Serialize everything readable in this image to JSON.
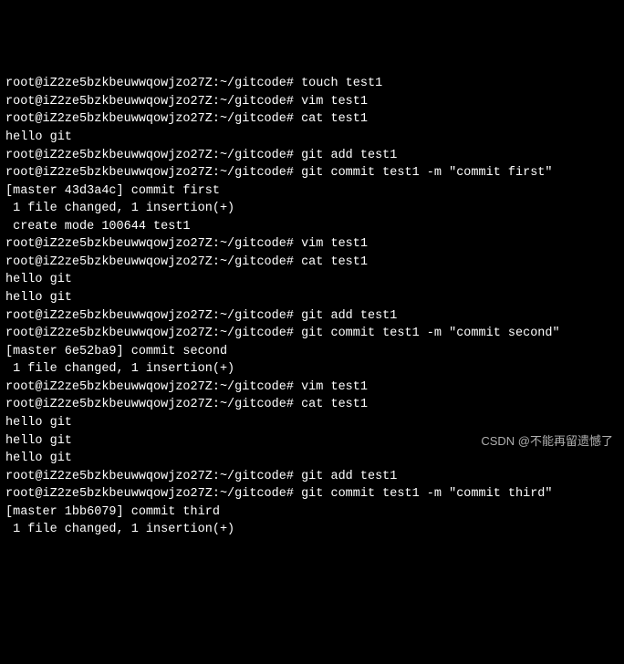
{
  "terminal": {
    "prompt_prefix": "root@iZ2ze5bzkbeuwwqowjzo27Z:~/gitcode#",
    "lines": [
      {
        "type": "prompt",
        "cmd": "touch test1"
      },
      {
        "type": "prompt",
        "cmd": "vim test1"
      },
      {
        "type": "prompt",
        "cmd": "cat test1"
      },
      {
        "type": "output",
        "text": "hello git"
      },
      {
        "type": "prompt",
        "cmd": "git add test1"
      },
      {
        "type": "prompt",
        "cmd": "git commit test1 -m \"commit first\""
      },
      {
        "type": "output",
        "text": "[master 43d3a4c] commit first"
      },
      {
        "type": "output",
        "text": " 1 file changed, 1 insertion(+)"
      },
      {
        "type": "output",
        "text": " create mode 100644 test1"
      },
      {
        "type": "prompt",
        "cmd": "vim test1"
      },
      {
        "type": "prompt",
        "cmd": "cat test1"
      },
      {
        "type": "output",
        "text": "hello git"
      },
      {
        "type": "output",
        "text": "hello git"
      },
      {
        "type": "prompt",
        "cmd": "git add test1"
      },
      {
        "type": "prompt",
        "cmd": "git commit test1 -m \"commit second\""
      },
      {
        "type": "output",
        "text": "[master 6e52ba9] commit second"
      },
      {
        "type": "output",
        "text": " 1 file changed, 1 insertion(+)"
      },
      {
        "type": "prompt",
        "cmd": "vim test1"
      },
      {
        "type": "prompt",
        "cmd": "cat test1"
      },
      {
        "type": "output",
        "text": "hello git"
      },
      {
        "type": "output",
        "text": "hello git"
      },
      {
        "type": "output",
        "text": "hello git"
      },
      {
        "type": "prompt",
        "cmd": "git add test1"
      },
      {
        "type": "prompt",
        "cmd": "git commit test1 -m \"commit third\""
      },
      {
        "type": "output",
        "text": "[master 1bb6079] commit third"
      },
      {
        "type": "output",
        "text": " 1 file changed, 1 insertion(+)"
      }
    ]
  },
  "watermark": "CSDN @不能再留遗憾了"
}
